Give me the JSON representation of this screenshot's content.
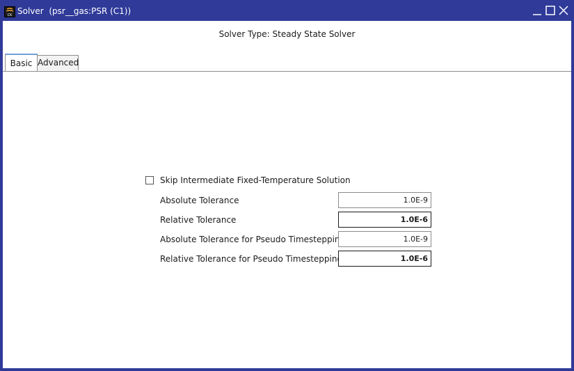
{
  "window": {
    "title": "Solver  (psr__gas:PSR (C1))",
    "icon": "ck-app-icon",
    "controls": [
      "minimize-icon",
      "maximize-icon",
      "close-icon"
    ],
    "colors": {
      "titlebar": "#2f3a99",
      "tab_accent": "#6fa0d8"
    }
  },
  "header": {
    "solver_type": "Solver Type: Steady State Solver"
  },
  "tabs": [
    {
      "label": "Basic",
      "active": true
    },
    {
      "label": "Advanced",
      "active": false
    }
  ],
  "basic": {
    "skip_checkbox": {
      "label": "Skip Intermediate Fixed-Temperature Solution",
      "checked": false
    },
    "fields": [
      {
        "label": "Absolute Tolerance",
        "value": "1.0E-9",
        "bold": false
      },
      {
        "label": "Relative Tolerance",
        "value": "1.0E-6",
        "bold": true
      },
      {
        "label": "Absolute Tolerance for Pseudo Timestepping",
        "value": "1.0E-9",
        "bold": false
      },
      {
        "label": "Relative Tolerance for Pseudo Timestepping",
        "value": "1.0E-6",
        "bold": true
      }
    ]
  }
}
